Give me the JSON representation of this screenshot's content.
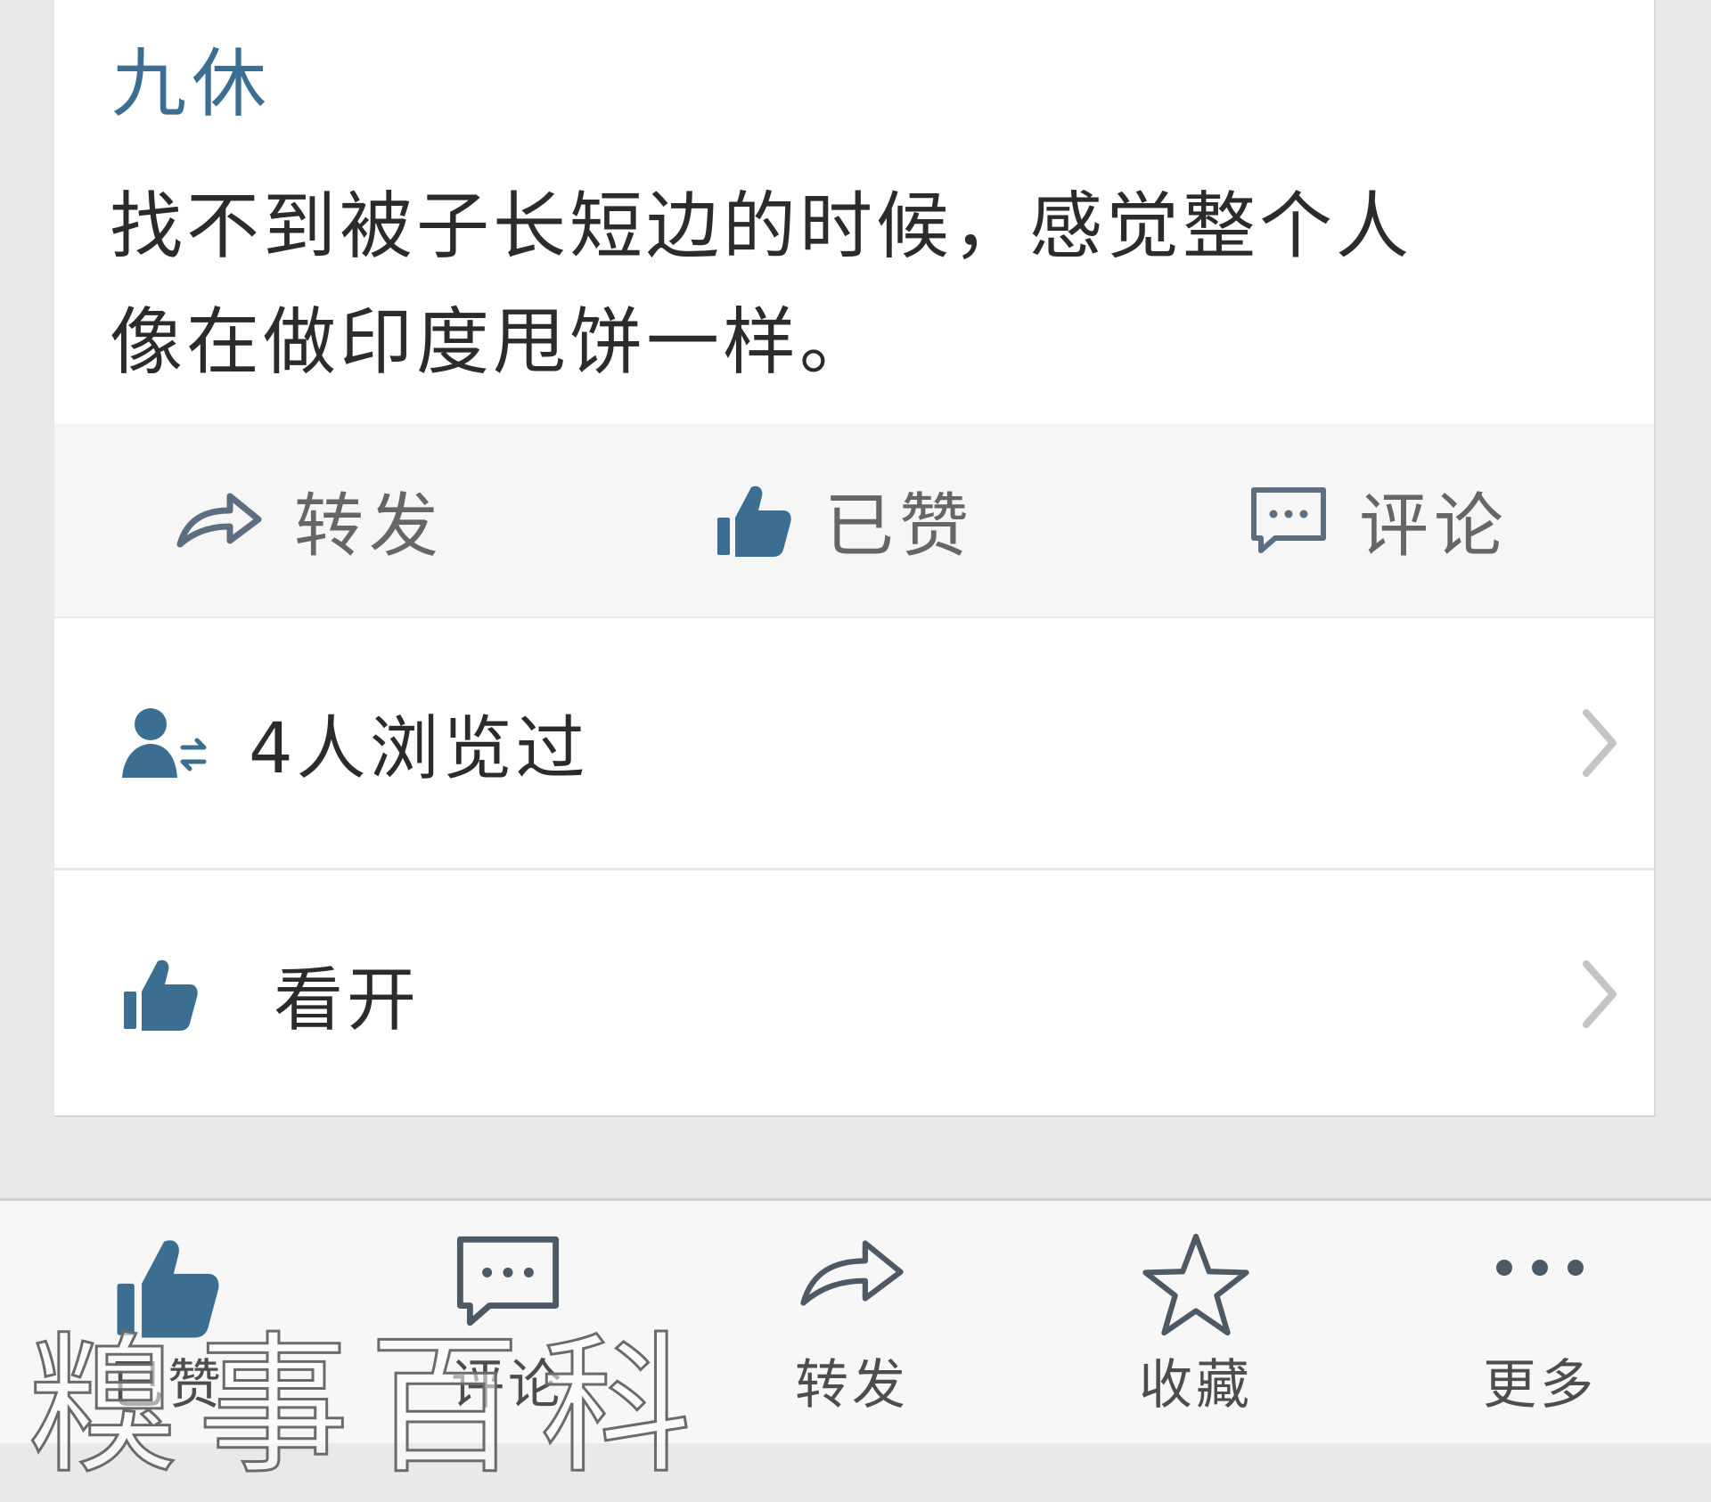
{
  "post": {
    "author": "九休",
    "text_line1": "找不到被子长短边的时候，感觉整个人",
    "text_line2": "像在做印度甩饼一样。"
  },
  "actions": {
    "repost": "转发",
    "liked": "已赞",
    "comment": "评论"
  },
  "rows": {
    "views": "4人浏览过",
    "liker": "看开"
  },
  "tabbar": {
    "like": "已赞",
    "comment": "评论",
    "repost": "转发",
    "favorite": "收藏",
    "more": "更多"
  },
  "watermark": "糗事百科",
  "colors": {
    "accent": "#3c6e92",
    "icon_gray": "#4d5a66"
  }
}
